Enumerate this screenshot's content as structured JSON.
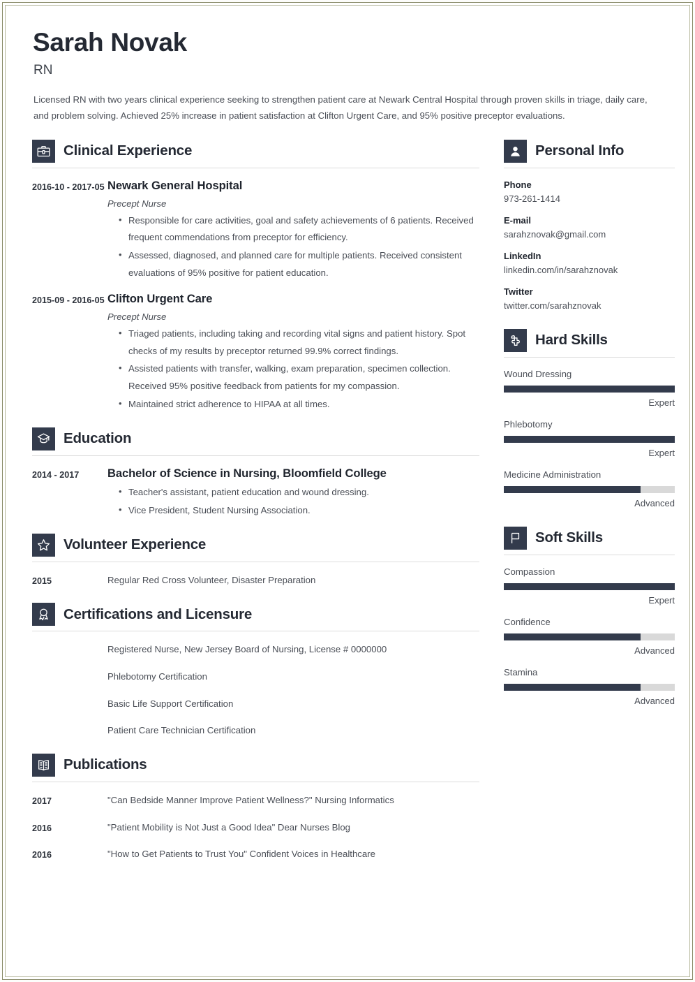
{
  "header": {
    "name": "Sarah Novak",
    "job_title": "RN",
    "summary": "Licensed RN with two years clinical experience seeking to strengthen patient care at Newark Central Hospital through proven skills in triage, daily care, and problem solving. Achieved 25% increase in patient satisfaction at Clifton Urgent Care, and 95% positive preceptor evaluations."
  },
  "colors": {
    "icon_tile": "#333b4c",
    "bar_fill": "#333b4c",
    "bar_track": "#d9d9d9",
    "heading_text": "#242933",
    "body_text": "#4a4e56",
    "page_border": "#8a8c6a",
    "rule": "#dcdcdc"
  },
  "sections": {
    "clinical_experience": {
      "title": "Clinical Experience",
      "icon": "briefcase-icon",
      "entries": [
        {
          "date": "2016-10 - 2017-05",
          "org": "Newark General Hospital",
          "role": "Precept Nurse",
          "bullets": [
            "Responsible for care activities, goal and safety achievements of 6 patients. Received frequent commendations from preceptor for efficiency.",
            "Assessed, diagnosed, and planned care for multiple patients. Received consistent evaluations of 95% positive for patient education."
          ]
        },
        {
          "date": "2015-09 - 2016-05",
          "org": "Clifton Urgent Care",
          "role": "Precept Nurse",
          "bullets": [
            "Triaged patients, including taking and recording vital signs and patient history. Spot checks of my results by preceptor returned 99.9% correct findings.",
            "Assisted patients with transfer, walking, exam preparation, specimen collection. Received 95% positive feedback from patients for my compassion.",
            "Maintained strict adherence to HIPAA at all times."
          ]
        }
      ]
    },
    "education": {
      "title": "Education",
      "icon": "graduation-cap-icon",
      "entries": [
        {
          "date": "2014 - 2017",
          "org": "Bachelor of Science in Nursing, Bloomfield College",
          "bullets": [
            "Teacher's assistant, patient education and wound dressing.",
            "Vice President, Student Nursing Association."
          ]
        }
      ]
    },
    "volunteer_experience": {
      "title": "Volunteer Experience",
      "icon": "star-icon",
      "entries": [
        {
          "date": "2015",
          "text": "Regular Red Cross Volunteer, Disaster Preparation"
        }
      ]
    },
    "certifications": {
      "title": "Certifications and Licensure",
      "icon": "award-ribbon-icon",
      "items": [
        "Registered Nurse, New Jersey Board of Nursing, License # 0000000",
        "Phlebotomy Certification",
        "Basic Life Support Certification",
        "Patient Care Technician Certification"
      ]
    },
    "publications": {
      "title": "Publications",
      "icon": "open-book-icon",
      "entries": [
        {
          "date": "2017",
          "text": "\"Can Bedside Manner Improve Patient Wellness?\" Nursing Informatics"
        },
        {
          "date": "2016",
          "text": "\"Patient Mobility is Not Just a Good Idea\" Dear Nurses Blog"
        },
        {
          "date": "2016",
          "text": "\"How to Get Patients to Trust You\" Confident Voices in Healthcare"
        }
      ]
    },
    "personal_info": {
      "title": "Personal Info",
      "icon": "person-icon",
      "fields": [
        {
          "label": "Phone",
          "value": "973-261-1414"
        },
        {
          "label": "E-mail",
          "value": "sarahznovak@gmail.com"
        },
        {
          "label": "LinkedIn",
          "value": "linkedin.com/in/sarahznovak"
        },
        {
          "label": "Twitter",
          "value": "twitter.com/sarahznovak"
        }
      ]
    },
    "hard_skills": {
      "title": "Hard Skills",
      "icon": "puzzle-piece-icon",
      "skills": [
        {
          "name": "Wound Dressing",
          "level": "Expert",
          "percent": 100
        },
        {
          "name": "Phlebotomy",
          "level": "Expert",
          "percent": 100
        },
        {
          "name": "Medicine Administration",
          "level": "Advanced",
          "percent": 80
        }
      ]
    },
    "soft_skills": {
      "title": "Soft Skills",
      "icon": "flag-icon",
      "skills": [
        {
          "name": "Compassion",
          "level": "Expert",
          "percent": 100
        },
        {
          "name": "Confidence",
          "level": "Advanced",
          "percent": 80
        },
        {
          "name": "Stamina",
          "level": "Advanced",
          "percent": 80
        }
      ]
    }
  }
}
